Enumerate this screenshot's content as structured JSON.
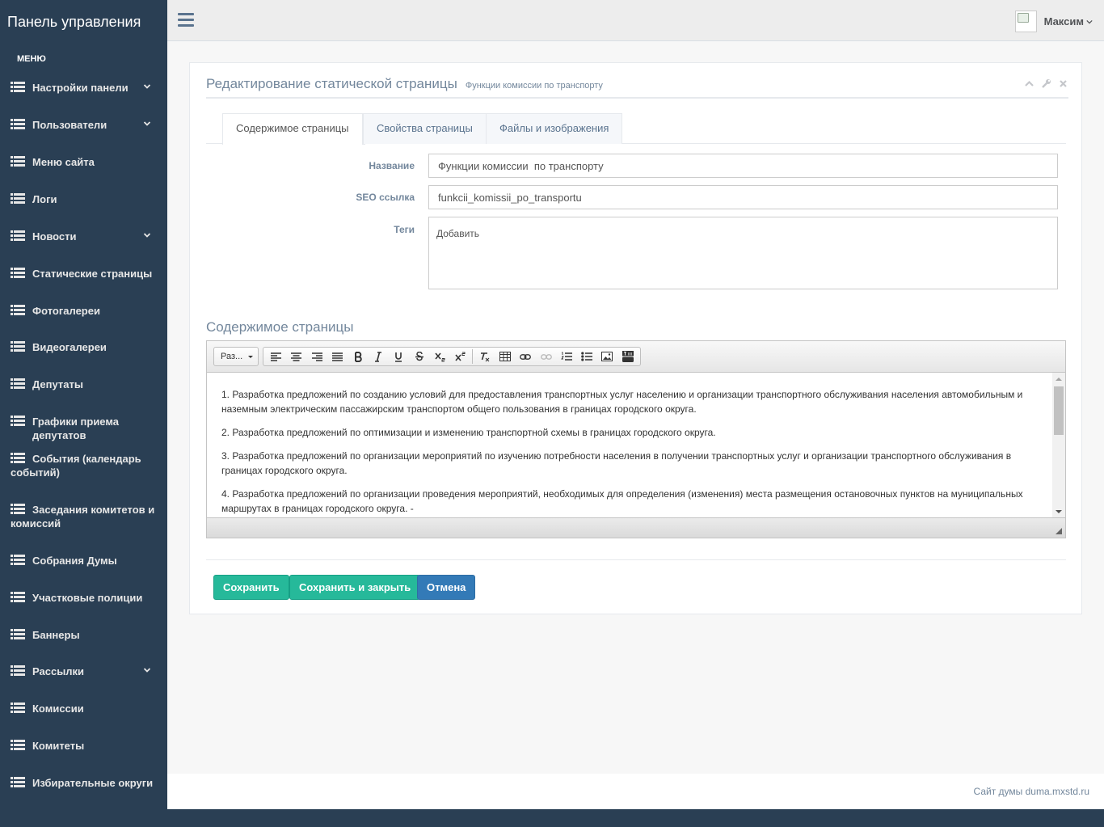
{
  "sidebar": {
    "brand": "Панель управления",
    "section": "МЕНЮ",
    "items": [
      {
        "label": "Настройки панели",
        "chevron": true
      },
      {
        "label": "Пользователи",
        "chevron": true
      },
      {
        "label": "Меню сайта",
        "chevron": false
      },
      {
        "label": "Логи",
        "chevron": false
      },
      {
        "label": "Новости",
        "chevron": true
      },
      {
        "label": "Статические страницы",
        "chevron": false
      },
      {
        "label": "Фотогалереи",
        "chevron": false
      },
      {
        "label": "Видеогалереи",
        "chevron": false
      },
      {
        "label": "Депутаты",
        "chevron": false
      },
      {
        "label": "Графики приема депутатов",
        "chevron": false
      },
      {
        "label": "События (календарь событий)",
        "chevron": false
      },
      {
        "label": "Заседания комитетов и комиссий",
        "chevron": false
      },
      {
        "label": "Собрания Думы",
        "chevron": false
      },
      {
        "label": "Участковые полиции",
        "chevron": false
      },
      {
        "label": "Баннеры",
        "chevron": false
      },
      {
        "label": "Рассылки",
        "chevron": true
      },
      {
        "label": "Комиссии",
        "chevron": false
      },
      {
        "label": "Комитеты",
        "chevron": false
      },
      {
        "label": "Избирательные округи",
        "chevron": false
      }
    ]
  },
  "topnav": {
    "user_name": "Максим"
  },
  "panel": {
    "title": "Редактирование статической страницы",
    "subtitle": "Функции комиссии по транспорту",
    "tabs": [
      "Содержимое страницы",
      "Свойства страницы",
      "Файлы и изображения"
    ],
    "fields": {
      "name_label": "Название",
      "name_value": "Функции комиссии  по транспорту",
      "seo_label": "SEO ссылка",
      "seo_value": "funkcii_komissii_po_transportu",
      "tags_label": "Теги",
      "tags_placeholder": "Добавить"
    },
    "content_title": "Содержимое страницы",
    "editor": {
      "format_select": "Раз...",
      "paragraphs": [
        "1. Разработка предложений по созданию условий для предоставления транспортных услуг населению и организации транспортного обслуживания населения автомобильным и наземным электрическим пассажирским транспортом общего пользования в границах городского округа.",
        "2. Разработка предложений по оптимизации и изменению транспортной схемы в границах городского округа.",
        "3. Разработка предложений по организации мероприятий по изучению потребности населения в получении транспортных услуг и организации транспортного обслуживания в границах городского округа.",
        "4. Разработка предложений по организации проведения мероприятий, необходимых для определения (изменения) места размещения остановочных пунктов на муниципальных маршрутах в границах городского округа. -"
      ]
    },
    "buttons": {
      "save": "Сохранить",
      "save_close": "Сохранить и закрыть",
      "cancel": "Отмена"
    }
  },
  "footer": {
    "text": "Сайт думы duma.mxstd.ru"
  },
  "colors": {
    "sidebar_bg": "#2A3F54",
    "success": "#26B99A",
    "primary": "#337AB7"
  }
}
